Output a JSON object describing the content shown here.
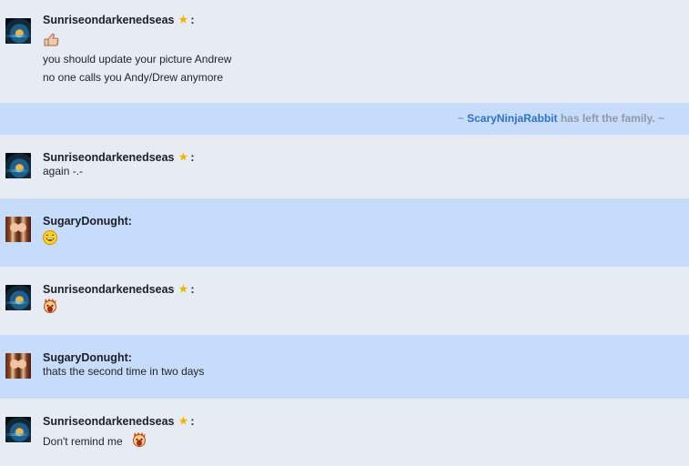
{
  "messages": [
    {
      "user": "Sunriseondarkenedseas",
      "star": "★",
      "colon": ":",
      "emoji": "thumbs-up-icon",
      "text1": "you should update your picture Andrew",
      "text2": "no one calls you Andy/Drew anymore"
    },
    {
      "prefix": "~",
      "user": "ScaryNinjaRabbit",
      "text": "has left the family.",
      "suffix": "~"
    },
    {
      "user": "Sunriseondarkenedseas",
      "star": "★",
      "colon": ":",
      "text": "again -.-"
    },
    {
      "user": "SugaryDonught:",
      "emoji": "laughing-face-icon"
    },
    {
      "user": "Sunriseondarkenedseas",
      "star": "★",
      "colon": ":",
      "emoji": "screaming-face-icon"
    },
    {
      "user": "SugaryDonught:",
      "text": "thats the second time in two days"
    },
    {
      "user": "Sunriseondarkenedseas",
      "star": "★",
      "colon": ":",
      "text": "Don't remind me",
      "emoji": "screaming-face-icon"
    }
  ]
}
